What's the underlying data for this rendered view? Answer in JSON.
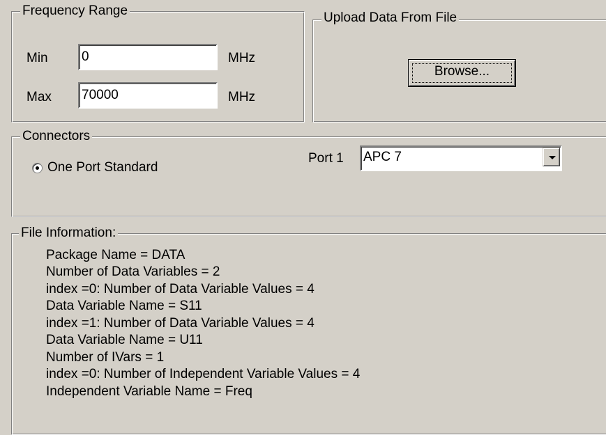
{
  "frequency": {
    "title": "Frequency Range",
    "min_label": "Min",
    "min_value": "0",
    "min_unit": "MHz",
    "max_label": "Max",
    "max_value": "70000",
    "max_unit": "MHz"
  },
  "upload": {
    "title": "Upload Data From File",
    "browse_label": "Browse..."
  },
  "connectors": {
    "title": "Connectors",
    "radio_label": "One Port Standard",
    "port_label": "Port 1",
    "port_value": "APC 7"
  },
  "file_info": {
    "title": "File Information:",
    "lines": [
      "Package Name = DATA",
      "Number of Data Variables = 2",
      "index =0: Number of Data Variable Values = 4",
      "Data Variable Name = S11",
      "index =1: Number of Data Variable Values = 4",
      "Data Variable Name = U11",
      "Number of IVars = 1",
      "index =0: Number of Independent Variable Values = 4",
      "Independent Variable Name = Freq"
    ]
  },
  "icons": {
    "combo_arrow": "chevron-down-icon",
    "radio": "radio-selected-icon"
  }
}
